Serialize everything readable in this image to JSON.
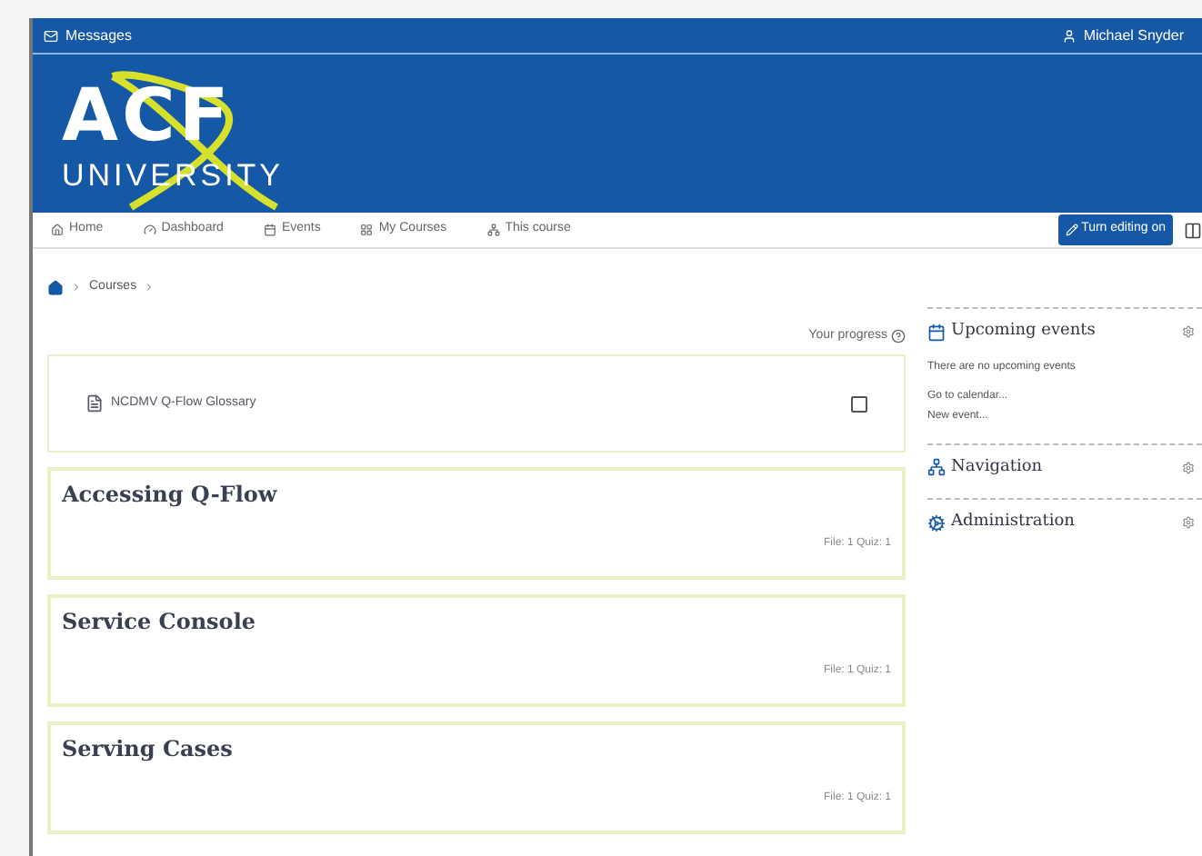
{
  "top_bar": {
    "messages": "Messages",
    "user": "Michael Snyder"
  },
  "logo": {
    "main": "ACF",
    "sub": "UNIVERSITY"
  },
  "nav": [
    {
      "label": "Home",
      "kind": "home"
    },
    {
      "label": "Dashboard",
      "kind": "dashboard"
    },
    {
      "label": "Events",
      "kind": "events"
    },
    {
      "label": "My Courses",
      "kind": "courses"
    },
    {
      "label": "This course",
      "kind": "course"
    }
  ],
  "edit_button": "Turn editing on",
  "breadcrumb": [
    "Courses"
  ],
  "progress_label": "Your progress",
  "activity": {
    "name": "NCDMV Q-Flow Glossary",
    "checked": false
  },
  "sections": [
    {
      "title": "Accessing Q-Flow",
      "summary": "File: 1 Quiz: 1"
    },
    {
      "title": "Service Console",
      "summary": "File: 1 Quiz: 1"
    },
    {
      "title": "Serving Cases",
      "summary": "File: 1 Quiz: 1"
    }
  ],
  "blocks": [
    {
      "title": "Upcoming events",
      "kind": "events",
      "text": "There are no upcoming events",
      "links": [
        "Go to calendar...",
        "New event..."
      ]
    },
    {
      "title": "Navigation",
      "kind": "navigation"
    },
    {
      "title": "Administration",
      "kind": "admin"
    }
  ]
}
